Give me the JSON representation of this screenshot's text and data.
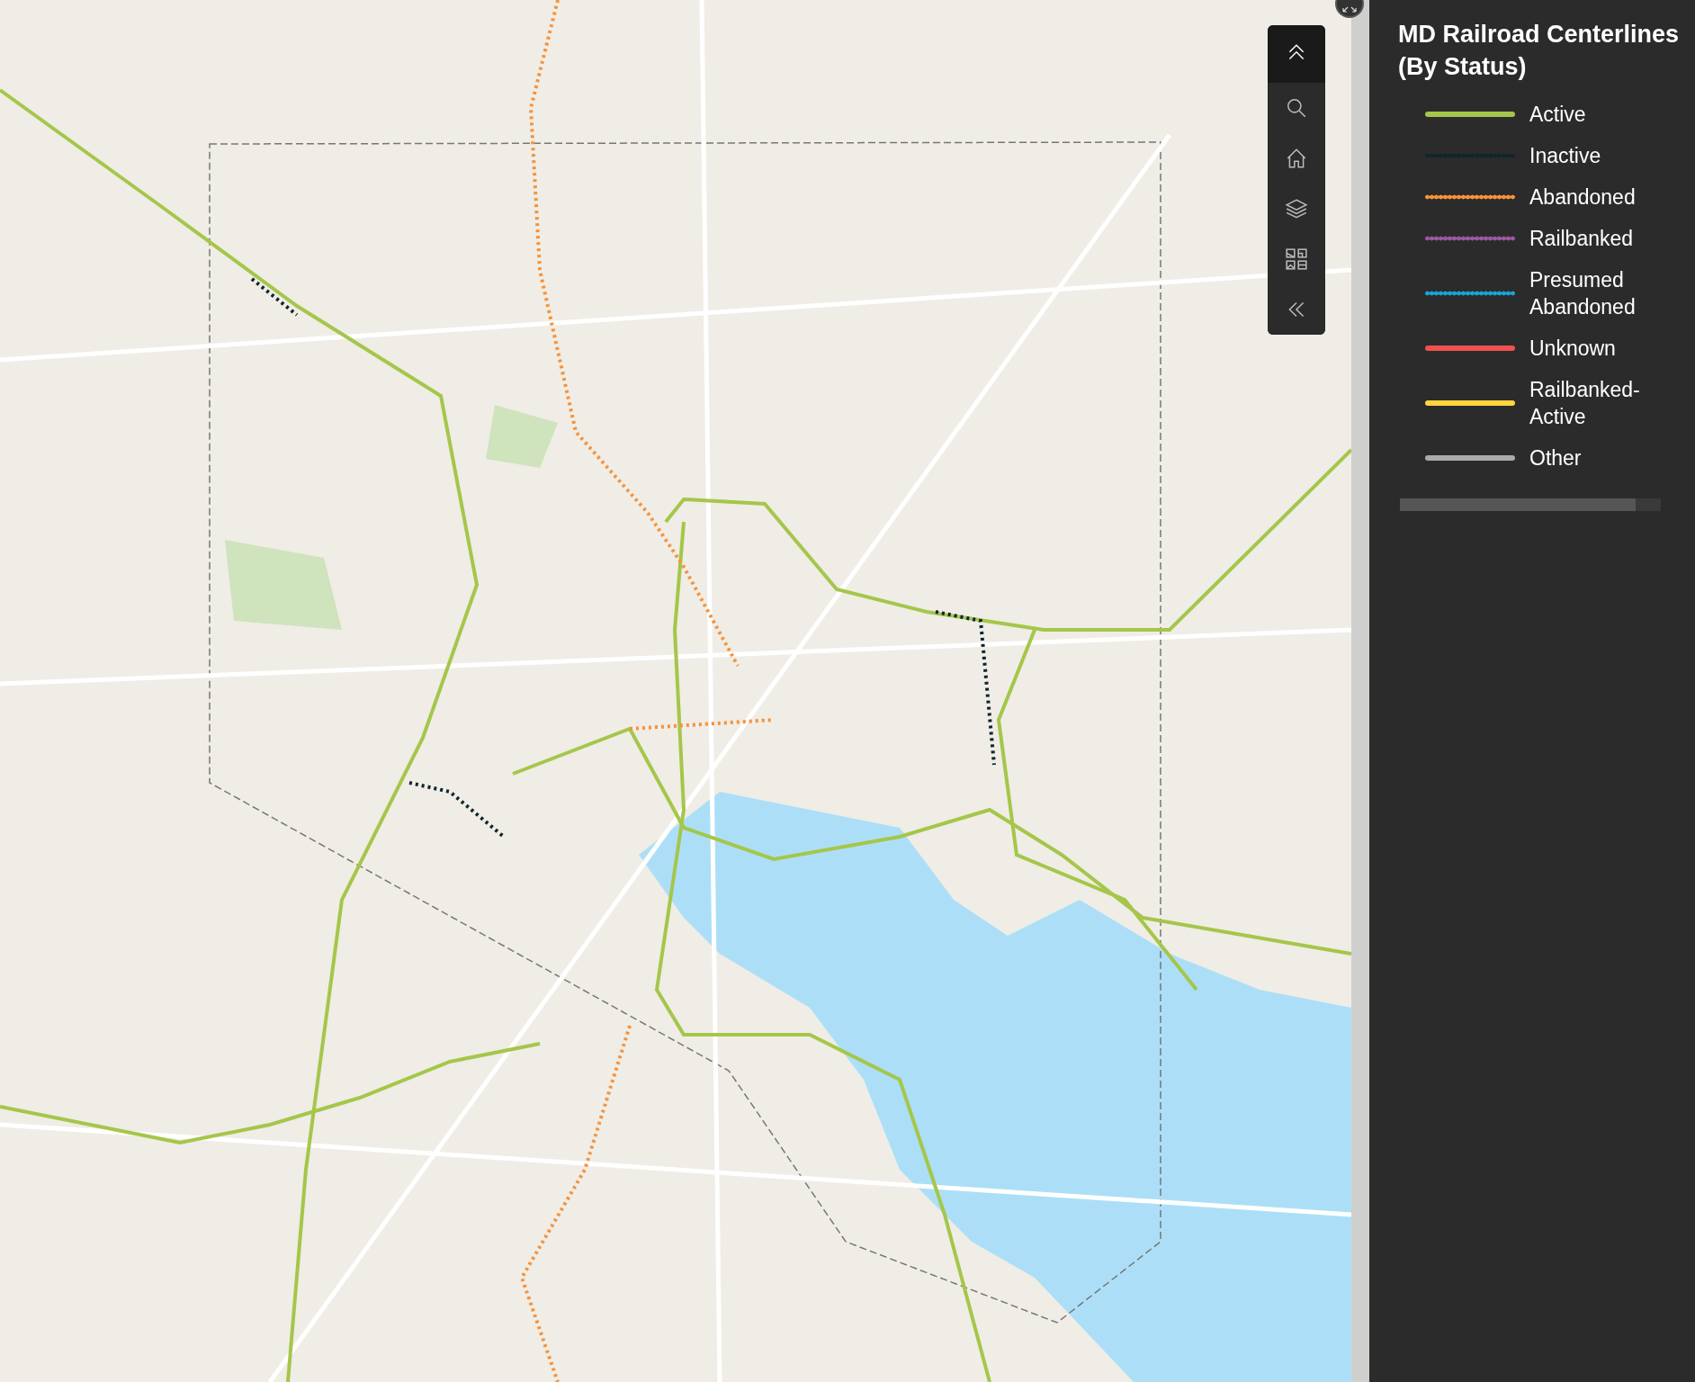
{
  "toolbar": {
    "buttons": [
      {
        "kind": "collapse"
      },
      {
        "kind": "search"
      },
      {
        "kind": "home"
      },
      {
        "kind": "layers"
      },
      {
        "kind": "basemap"
      },
      {
        "kind": "expand"
      }
    ]
  },
  "legend": {
    "title": "MD Railroad Centerlines (By Status)",
    "items": [
      {
        "label": "Active",
        "color": "#a5c64a",
        "kind": "solid"
      },
      {
        "label": "Inactive",
        "color": "#10252d",
        "kind": "dotted"
      },
      {
        "label": "Abandoned",
        "color": "#f7923a",
        "kind": "dotted"
      },
      {
        "label": "Railbanked",
        "color": "#9b57a0",
        "kind": "dotted"
      },
      {
        "label": "Presumed Abandoned",
        "color": "#16a6d6",
        "kind": "dotted"
      },
      {
        "label": "Unknown",
        "color": "#ef5050",
        "kind": "solid"
      },
      {
        "label": "Railbanked-Active",
        "color": "#fcd53f",
        "kind": "solid"
      },
      {
        "label": "Other",
        "color": "#aaaaaa",
        "kind": "solid"
      }
    ]
  }
}
